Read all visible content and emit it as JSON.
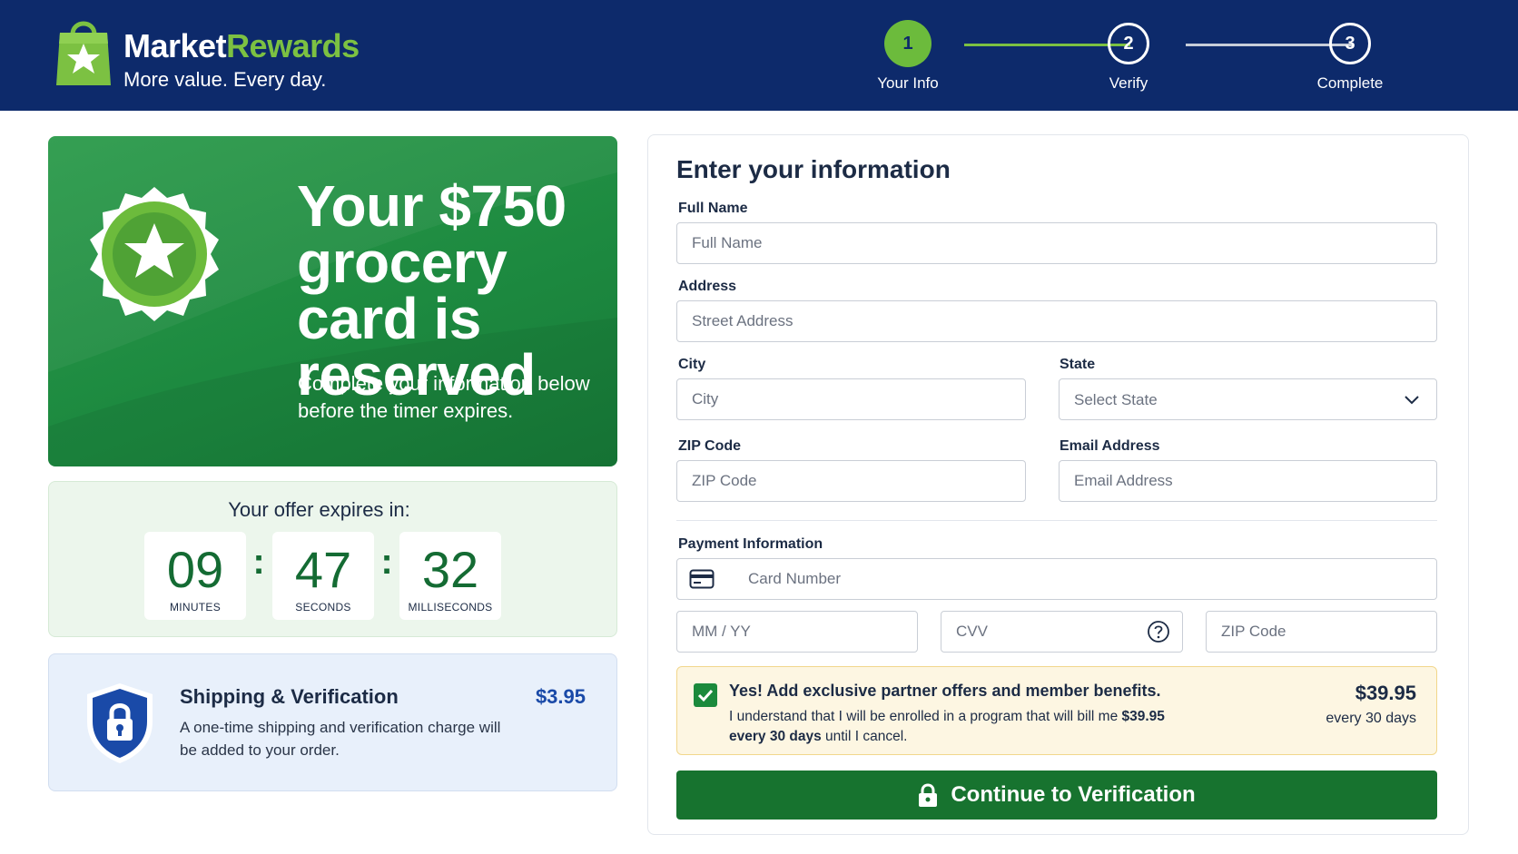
{
  "brand": {
    "name_part1": "Market",
    "name_part2": "Rewards",
    "tagline": "More value. Every day."
  },
  "steps": [
    {
      "number": "1",
      "label": "Your Info",
      "state": "active"
    },
    {
      "number": "2",
      "label": "Verify",
      "state": "upcoming"
    },
    {
      "number": "3",
      "label": "Complete",
      "state": "upcoming"
    }
  ],
  "hero": {
    "title": "Your $750 grocery card is reserved",
    "subtitle": "Complete your information below before the timer expires."
  },
  "timer": {
    "title": "Your offer expires in:",
    "minutes": "09",
    "minutes_label": "MINUTES",
    "seconds": "47",
    "seconds_label": "SECONDS",
    "milliseconds": "32",
    "milliseconds_label": "MILLISECONDS",
    "separator": ":"
  },
  "shipping": {
    "title": "Shipping & Verification",
    "price": "$3.95",
    "description": "A one-time shipping and verification charge will be added to your order."
  },
  "form": {
    "title": "Enter your information",
    "full_name": {
      "label": "Full Name",
      "placeholder": "Full Name"
    },
    "address": {
      "label": "Address",
      "placeholder": "Street Address"
    },
    "city": {
      "label": "City",
      "placeholder": "City"
    },
    "state": {
      "label": "State",
      "selected": "Select State"
    },
    "zip": {
      "label": "ZIP Code",
      "placeholder": "ZIP Code"
    },
    "email": {
      "label": "Email Address",
      "placeholder": "Email Address"
    },
    "payment": {
      "label": "Payment Information",
      "card_placeholder": "Card Number",
      "expiry_placeholder": "MM / YY",
      "cvv_placeholder": "CVV",
      "zip_placeholder": "ZIP Code"
    }
  },
  "offer": {
    "checked": true,
    "headline": "Yes! Add exclusive partner offers and member benefits.",
    "text_before": "I understand that I will be enrolled in a program that will bill me ",
    "text_bold": "$39.95 every 30 days",
    "text_after": " until I cancel.",
    "price": "$39.95",
    "period": "every 30 days"
  },
  "cta": {
    "label": "Continue to Verification"
  },
  "colors": {
    "header_bg": "#0d2a6b",
    "brand_green": "#7cc142",
    "hero_green": "#1d8a40",
    "timer_digits": "#146b33",
    "cta_bg": "#17732f",
    "price_blue": "#1a4aa8"
  },
  "icons": {
    "logo": "shopping-bag-star-icon",
    "badge": "star-badge-icon",
    "shield": "shield-lock-icon",
    "card": "credit-card-icon",
    "help": "question-circle-icon",
    "check": "checkmark-icon",
    "lock": "lock-icon",
    "chevron": "chevron-down-icon"
  }
}
